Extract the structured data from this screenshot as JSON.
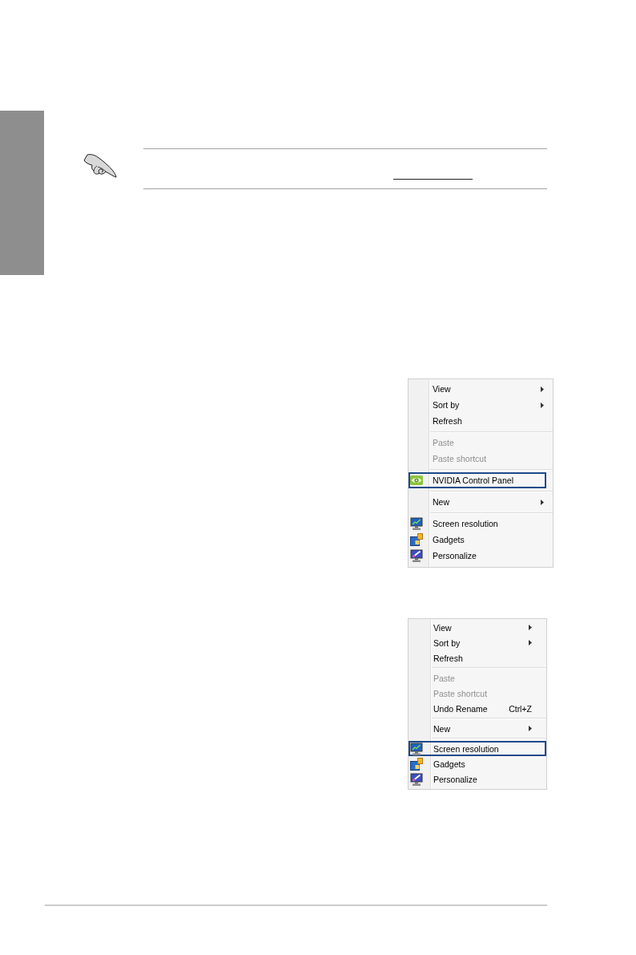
{
  "context_menus": [
    {
      "sections": [
        {
          "items": [
            {
              "label": "View",
              "kind": "plain",
              "submenu": true,
              "disabled": false,
              "highlighted": false
            },
            {
              "label": "Sort by",
              "kind": "plain",
              "submenu": true,
              "disabled": false,
              "highlighted": false
            },
            {
              "label": "Refresh",
              "kind": "plain",
              "submenu": false,
              "disabled": false,
              "highlighted": false
            }
          ]
        },
        {
          "items": [
            {
              "label": "Paste",
              "kind": "plain",
              "submenu": false,
              "disabled": true,
              "highlighted": false
            },
            {
              "label": "Paste shortcut",
              "kind": "plain",
              "submenu": false,
              "disabled": true,
              "highlighted": false
            }
          ]
        },
        {
          "items": [
            {
              "label": "NVIDIA Control Panel",
              "kind": "eye",
              "submenu": false,
              "disabled": false,
              "highlighted": true
            }
          ]
        },
        {
          "items": [
            {
              "label": "New",
              "kind": "plain",
              "submenu": true,
              "disabled": false,
              "highlighted": false
            }
          ]
        },
        {
          "items": [
            {
              "label": "Screen resolution",
              "kind": "monitor",
              "submenu": false,
              "disabled": false,
              "highlighted": false
            },
            {
              "label": "Gadgets",
              "kind": "gadgets",
              "submenu": false,
              "disabled": false,
              "highlighted": false
            },
            {
              "label": "Personalize",
              "kind": "brush",
              "submenu": false,
              "disabled": false,
              "highlighted": false
            }
          ]
        }
      ]
    },
    {
      "sections": [
        {
          "items": [
            {
              "label": "View",
              "kind": "plain",
              "submenu": true,
              "disabled": false,
              "highlighted": false
            },
            {
              "label": "Sort by",
              "kind": "plain",
              "submenu": true,
              "disabled": false,
              "highlighted": false
            },
            {
              "label": "Refresh",
              "kind": "plain",
              "submenu": false,
              "disabled": false,
              "highlighted": false
            }
          ]
        },
        {
          "items": [
            {
              "label": "Paste",
              "kind": "plain",
              "submenu": false,
              "disabled": true,
              "highlighted": false
            },
            {
              "label": "Paste shortcut",
              "kind": "plain",
              "submenu": false,
              "disabled": true,
              "highlighted": false
            },
            {
              "label": "Undo Rename",
              "shortcut": "Ctrl+Z",
              "kind": "plain",
              "submenu": false,
              "disabled": false,
              "highlighted": false
            }
          ]
        },
        {
          "items": [
            {
              "label": "New",
              "kind": "plain",
              "submenu": true,
              "disabled": false,
              "highlighted": false
            }
          ]
        },
        {
          "items": [
            {
              "label": "Screen resolution",
              "kind": "monitor",
              "submenu": false,
              "disabled": false,
              "highlighted": true
            },
            {
              "label": "Gadgets",
              "kind": "gadgets",
              "submenu": false,
              "disabled": false,
              "highlighted": false
            },
            {
              "label": "Personalize",
              "kind": "brush",
              "submenu": false,
              "disabled": false,
              "highlighted": false
            }
          ]
        }
      ]
    }
  ]
}
